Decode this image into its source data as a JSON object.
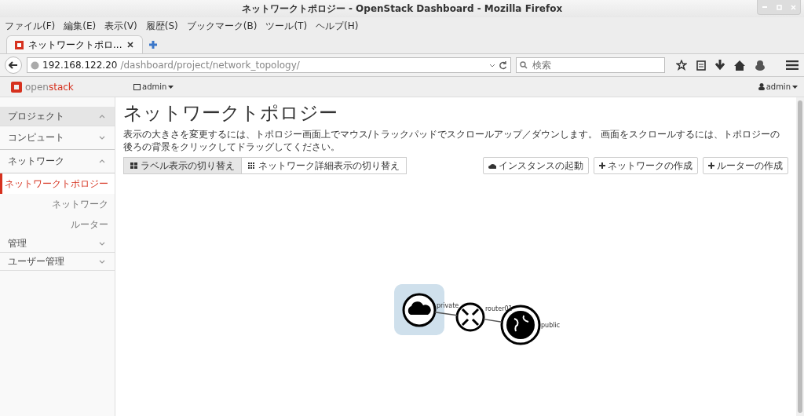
{
  "window": {
    "title": "ネットワークトポロジー - OpenStack Dashboard - Mozilla Firefox"
  },
  "menu": [
    "ファイル(F)",
    "編集(E)",
    "表示(V)",
    "履歴(S)",
    "ブックマーク(B)",
    "ツール(T)",
    "ヘルプ(H)"
  ],
  "tabs": [
    {
      "label": "ネットワークトポロ...",
      "selected": true
    }
  ],
  "address_bar": {
    "host": "192.168.122.20",
    "path": "/dashboard/project/network_topology/"
  },
  "search": {
    "placeholder": "検索"
  },
  "header": {
    "logo_prefix": "open",
    "logo_suffix": "stack",
    "project_menu": "admin",
    "user_menu": "admin"
  },
  "sidebar": [
    {
      "label": "プロジェクト",
      "kind": "panel",
      "expanded": true,
      "children": [
        {
          "label": "コンピュート",
          "kind": "group",
          "expanded": false
        },
        {
          "label": "ネットワーク",
          "kind": "group",
          "expanded": true,
          "children": [
            {
              "label": "ネットワークトポロジー",
              "kind": "link",
              "selected": true
            },
            {
              "label": "ネットワーク",
              "kind": "link",
              "selected": false
            },
            {
              "label": "ルーター",
              "kind": "link",
              "selected": false
            }
          ]
        }
      ]
    },
    {
      "label": "管理",
      "kind": "panel",
      "expanded": false
    },
    {
      "label": "ユーザー管理",
      "kind": "panel",
      "expanded": false
    }
  ],
  "page": {
    "title": "ネットワークトポロジー",
    "help": "表示の大きさを変更するには、トポロジー画面上でマウス/トラックパッドでスクロールアップ／ダウンします。 画面をスクロールするには、トポロジーの後ろの背景をクリックしてドラッグしてください。"
  },
  "view_toggles": [
    {
      "label": "ラベル表示の切り替え",
      "kind": "labels",
      "selected": true
    },
    {
      "label": "ネットワーク詳細表示の切り替え",
      "kind": "details",
      "selected": false
    }
  ],
  "actions": [
    {
      "label": "インスタンスの起動",
      "kind": "launch"
    },
    {
      "label": "ネットワークの作成",
      "kind": "create"
    },
    {
      "label": "ルーターの作成",
      "kind": "create"
    }
  ],
  "topology": {
    "nodes": [
      {
        "kind": "network",
        "label": "private",
        "highlighted": true
      },
      {
        "kind": "router",
        "label": "router01"
      },
      {
        "kind": "external",
        "label": "public"
      }
    ]
  }
}
